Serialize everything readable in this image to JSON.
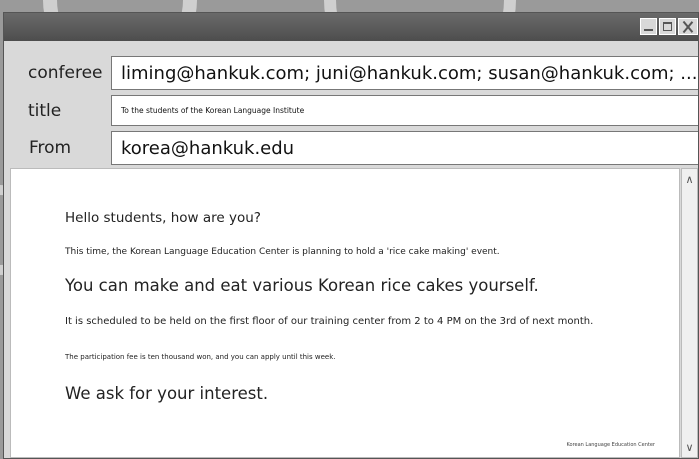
{
  "window": {
    "controls": {
      "minimize_icon": "minimize-icon",
      "maximize_icon": "maximize-icon",
      "close_icon": "close-icon"
    }
  },
  "header": {
    "conferee_label": "conferee",
    "conferee_value": "liming@hankuk.com; juni@hankuk.com; susan@hankuk.com; ...",
    "title_label": "title",
    "title_value": "To the students of the Korean Language Institute",
    "from_label": "From",
    "from_value": "korea@hankuk.edu"
  },
  "message": {
    "greeting": "Hello students, how are you?",
    "line1": "This time, the Korean Language Education Center is planning to hold a 'rice cake making' event.",
    "line2": "You can make and eat various Korean rice cakes yourself.",
    "line3": "It is scheduled to be held on the first floor of our training center from 2 to 4 PM on the 3rd of next month.",
    "line4": "The participation fee is ten thousand won, and you can apply until this week.",
    "line5": "We ask for your interest.",
    "signature": "Korean Language Education Center"
  }
}
